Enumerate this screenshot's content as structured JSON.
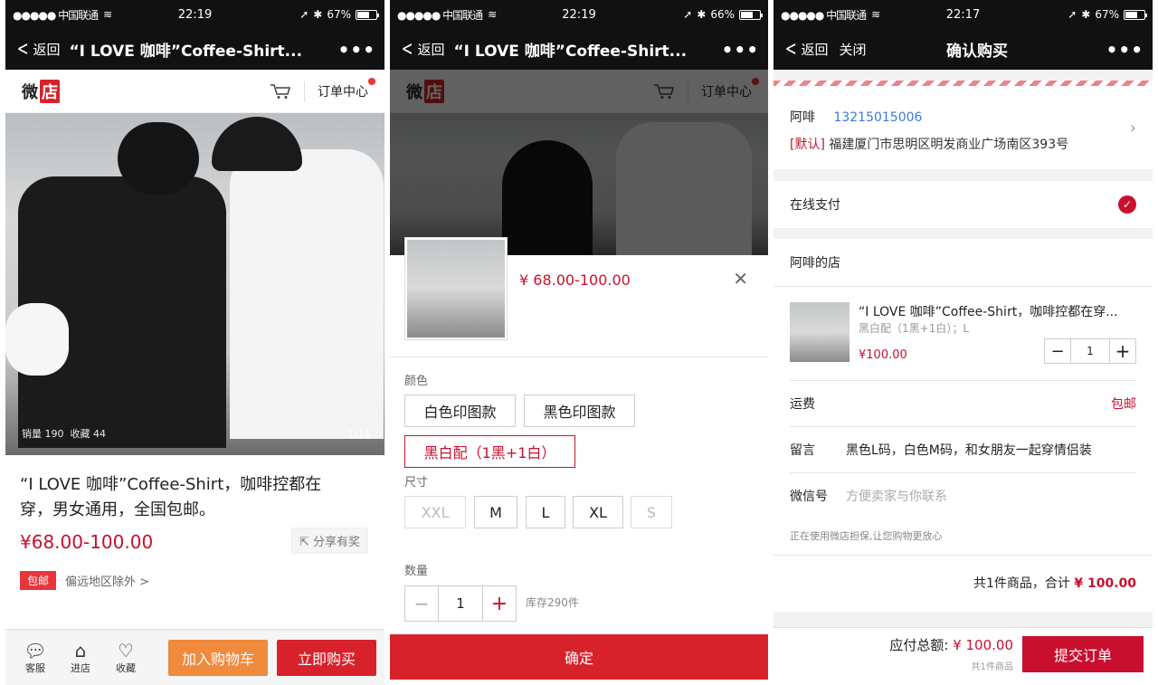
{
  "status": [
    {
      "carrier": "●●●●● 中国联通",
      "time": "22:19",
      "battery": "67%",
      "level": 0.67
    },
    {
      "carrier": "●●●●● 中国联通",
      "time": "22:19",
      "battery": "66%",
      "level": 0.66
    },
    {
      "carrier": "●●●●● 中国联通",
      "time": "22:17",
      "battery": "67%",
      "level": 0.67
    }
  ],
  "nav": {
    "back": "返回",
    "close": "关闭",
    "title_product": "“I LOVE 咖啡”Coffee-Shirt...",
    "title_confirm": "确认购买",
    "more": "•••"
  },
  "shop": {
    "logo_a": "微",
    "logo_b": "店",
    "orders": "订单中心"
  },
  "product": {
    "sales": "销量 190",
    "fav": "收藏 44",
    "pager": "1/14",
    "title": "“I LOVE 咖啡”Coffee-Shirt，咖啡控都在穿，男女通用，全国包邮。",
    "price": "¥68.00-100.00",
    "share": "分享有奖",
    "free_tag": "包邮",
    "exclude": "偏远地区除外 >"
  },
  "bottombar": {
    "service": "客服",
    "store": "进店",
    "fav": "收藏",
    "add_cart": "加入购物车",
    "buy_now": "立即购买"
  },
  "sheet": {
    "price": "¥ 68.00-100.00",
    "color_label": "颜色",
    "colors": [
      "白色印图款",
      "黑色印图款",
      "黑白配（1黑+1白）"
    ],
    "size_label": "尺寸",
    "sizes": [
      "XXL",
      "M",
      "L",
      "XL",
      "S"
    ],
    "qty_label": "数量",
    "qty": "1",
    "stock": "库存290件",
    "confirm": "确定"
  },
  "order": {
    "name": "阿啡",
    "phone": "13215015006",
    "default_tag": "[默认]",
    "address": "福建厦门市思明区明发商业广场南区393号",
    "pay": "在线支付",
    "store": "阿啡的店",
    "item_title": "“I LOVE 咖啡”Coffee-Shirt，咖啡控都在穿...",
    "item_spec": "黑白配（1黑+1白）；L",
    "item_price": "¥100.00",
    "qty": "1",
    "ship_label": "运费",
    "ship_value": "包邮",
    "msg_label": "留言",
    "msg_value": "黑色L码，白色M码，和女朋友一起穿情侣装",
    "wx_label": "微信号",
    "wx_placeholder": "方便卖家与你联系",
    "guarantee": "正在使用微店担保,让您购物更放心",
    "summary_count": "共1件商品，合计",
    "summary_total": "¥ 100.00",
    "pay_label": "应付总额:",
    "pay_total": "¥ 100.00",
    "pay_count": "共1件商品",
    "submit": "提交订单"
  },
  "colors": {
    "accent": "#c8102e",
    "orange": "#f08a3c",
    "navbar": "#111111"
  }
}
